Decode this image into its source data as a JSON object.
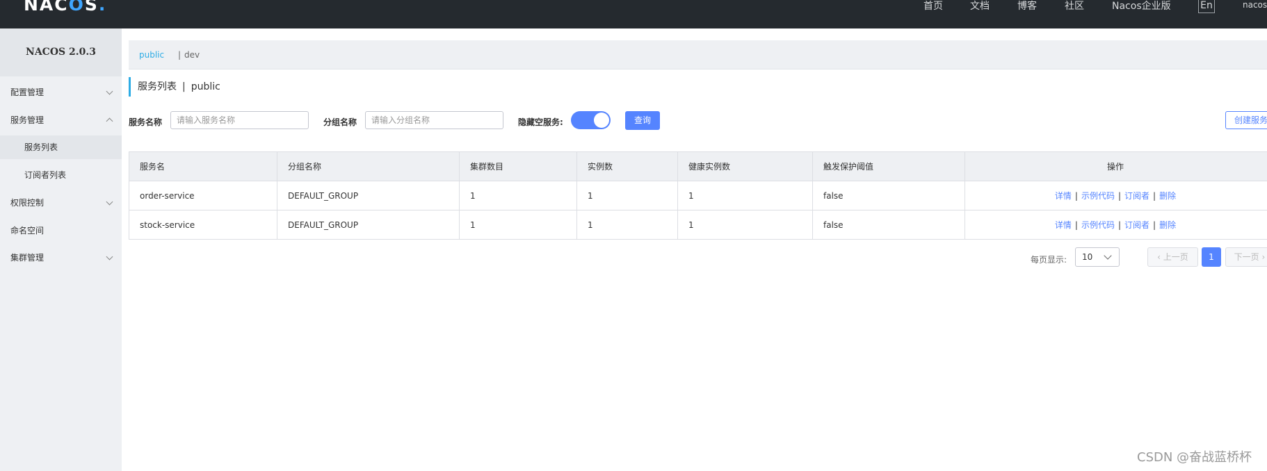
{
  "header": {
    "logo": "NACOS",
    "nav": [
      {
        "label": "首页"
      },
      {
        "label": "文档"
      },
      {
        "label": "博客"
      },
      {
        "label": "社区"
      },
      {
        "label": "Nacos企业版"
      }
    ],
    "lang": "En",
    "user": "nacos"
  },
  "sidebar": {
    "title": "NACOS 2.0.3",
    "items": [
      {
        "label": "配置管理",
        "expandable": true,
        "expanded": false
      },
      {
        "label": "服务管理",
        "expandable": true,
        "expanded": true
      },
      {
        "label": "服务列表",
        "sub": true,
        "active": true
      },
      {
        "label": "订阅者列表",
        "sub": true
      },
      {
        "label": "权限控制",
        "expandable": true,
        "expanded": false
      },
      {
        "label": "命名空间",
        "expandable": false
      },
      {
        "label": "集群管理",
        "expandable": true,
        "expanded": false
      }
    ]
  },
  "namespace": {
    "current": "public",
    "separator": "|",
    "other": "dev"
  },
  "page": {
    "title": "服务列表",
    "separator": "|",
    "namespace": "public"
  },
  "filters": {
    "service_name_label": "服务名称",
    "service_name_placeholder": "请输入服务名称",
    "group_name_label": "分组名称",
    "group_name_placeholder": "请输入分组名称",
    "hide_empty_label": "隐藏空服务:",
    "hide_empty_on": true,
    "query_label": "查询",
    "create_label": "创建服务"
  },
  "table": {
    "columns": [
      "服务名",
      "分组名称",
      "集群数目",
      "实例数",
      "健康实例数",
      "触发保护阈值",
      "操作"
    ],
    "rows": [
      {
        "service": "order-service",
        "group": "DEFAULT_GROUP",
        "clusters": "1",
        "instances": "1",
        "healthy": "1",
        "threshold": "false"
      },
      {
        "service": "stock-service",
        "group": "DEFAULT_GROUP",
        "clusters": "1",
        "instances": "1",
        "healthy": "1",
        "threshold": "false"
      }
    ],
    "actions": {
      "detail": "详情",
      "sample": "示例代码",
      "subscriber": "订阅者",
      "delete": "删除",
      "sep": "|"
    }
  },
  "pagination": {
    "per_page_label": "每页显示:",
    "per_page": "10",
    "prev_label": "上一页",
    "next_label": "下一页",
    "current_page": "1"
  },
  "watermark": "CSDN @奋战蓝桥杯",
  "colors": {
    "header_bg": "#252a2f",
    "sidebar_bg": "#eef0f3",
    "accent": "#5584ff",
    "namespace_active": "#2dace5"
  }
}
